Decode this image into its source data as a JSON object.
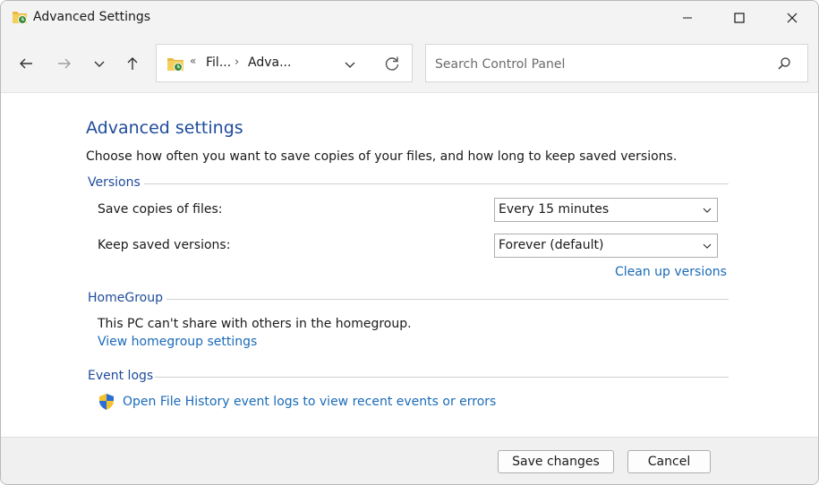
{
  "window": {
    "title": "Advanced Settings"
  },
  "nav": {
    "breadcrumb_overflow": "«",
    "crumbs": [
      "Fil...",
      "Adva..."
    ],
    "separator": "›"
  },
  "search": {
    "placeholder": "Search Control Panel"
  },
  "page": {
    "heading": "Advanced settings",
    "description": "Choose how often you want to save copies of your files, and how long to keep saved versions."
  },
  "versions": {
    "title": "Versions",
    "save_copies_label": "Save copies of files:",
    "save_copies_value": "Every 15 minutes",
    "keep_versions_label": "Keep saved versions:",
    "keep_versions_value": "Forever (default)",
    "cleanup_link": "Clean up versions"
  },
  "homegroup": {
    "title": "HomeGroup",
    "message": "This PC can't share with others in the homegroup.",
    "link": "View homegroup settings"
  },
  "event_logs": {
    "title": "Event logs",
    "link": "Open File History event logs to view recent events or errors"
  },
  "footer": {
    "save_label": "Save changes",
    "cancel_label": "Cancel"
  },
  "colors": {
    "heading": "#1e4b9a",
    "link": "#1a6bb8",
    "chrome": "#f3f3f3"
  }
}
